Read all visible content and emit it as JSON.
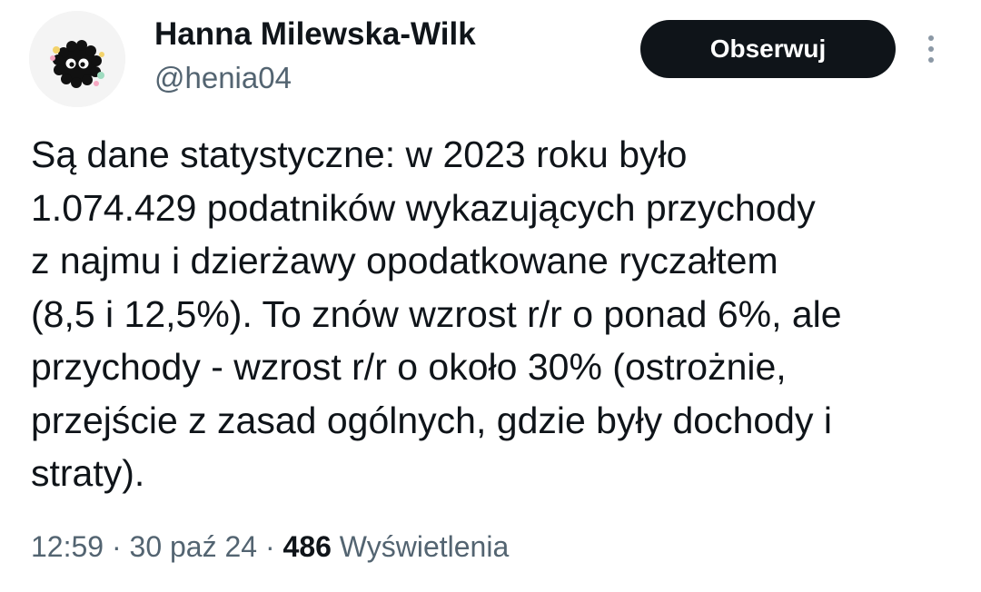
{
  "author": {
    "display_name": "Hanna Milewska-Wilk",
    "handle": "@henia04",
    "avatar_icon": "soot-sprite-avatar"
  },
  "actions": {
    "follow_label": "Obserwuj",
    "more_icon": "more-vertical-icon"
  },
  "tweet": {
    "text": "Są dane statystyczne: w 2023 roku było\n1.074.429 podatników wykazujących przychody\nz najmu i dzierżawy opodatkowane ryczałtem\n(8,5 i 12,5%). To znów wzrost r/r o ponad 6%, ale\nprzychody - wzrost r/r o około 30% (ostrożnie,\nprzejście z zasad ogólnych, gdzie były dochody i\nstraty)."
  },
  "meta": {
    "time": "12:59",
    "separator": "·",
    "date": "30 paź 24",
    "views_count": "486",
    "views_label": "Wyświetlenia"
  },
  "colors": {
    "text": "#0f1419",
    "secondary": "#536471",
    "button_bg": "#0f1419",
    "button_text": "#ffffff"
  }
}
